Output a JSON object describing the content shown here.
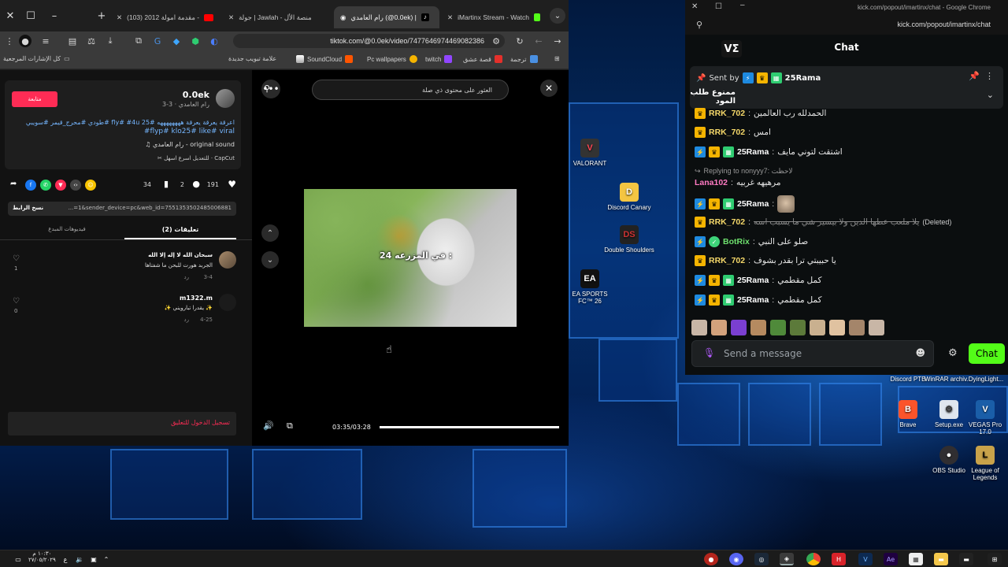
{
  "colors": {
    "kick_green": "#53fc18",
    "tiktok_red": "#fe2c55",
    "link_blue": "#75b6ff",
    "rrk_gold": "#f5d86a",
    "rama_white": "#ffffff",
    "lana_pink": "#ff7ac3",
    "botrix_green": "#6ee06e"
  },
  "chrome": {
    "tabs": [
      {
        "title": "iMartinx Stream - Watch",
        "icon": "kick-icon"
      },
      {
        "title": "رام العامدي (@0.0ek) |",
        "icon": "tiktok-icon"
      },
      {
        "title": "جولة | Jawlah - منصة الأل",
        "icon": "jawlah-icon"
      },
      {
        "title": "(103) مقدمة امولة 2012 -",
        "icon": "youtube-icon"
      }
    ],
    "new_tab": "+",
    "url": "tiktok.com/@0.0ek/video/7477646974469082386",
    "bookmarks": [
      {
        "label": "ترجمة",
        "icon": "translate-icon"
      },
      {
        "label": "قصة عشق",
        "icon": "bookmark-icon"
      },
      {
        "label": "twitch",
        "icon": "twitch-icon"
      },
      {
        "label": "Pc wallpapers",
        "icon": "wallpaper-icon"
      },
      {
        "label": "SoundCloud",
        "icon": "soundcloud-icon"
      },
      {
        "label": "علامة تبويب جديدة",
        "icon": "chrome-icon"
      },
      {
        "label": "كل الإشارات المرجعية",
        "icon": "folder-icon"
      }
    ]
  },
  "tiktok": {
    "username": "0.0ek",
    "display_name": "رام العامدي",
    "date": "3-3",
    "follow_label": "متابعة",
    "description": "اعرقة يعرقة يعرقة ههههههههه #25 fly# #4u #طودي #محرج_قيمر #سويبي",
    "hashtags2": "flyp# klo25# like# viral#",
    "sound": "original sound - رام العامدي",
    "capcut": "CapCut · للتعديل اسرع اسهل",
    "likes": "191",
    "comments_count": "2",
    "saves": "34",
    "copy_link_label": "نسخ الرابط",
    "link_text": "...=1&sender_device=pc&web_id=7551353502485006881",
    "tab_comments": "تعليقات (2)",
    "tab_creator_videos": "فيديوهات المبدع",
    "comments": [
      {
        "user": "سبحان الله لا إله إلا الله",
        "text": "الجربد هورت للبحن ما شفتاها",
        "date": "3-4",
        "reply": "رد",
        "likes": "1"
      },
      {
        "user": "m1322.m",
        "text": "✨ يقدرا تبارويني ✨",
        "date": "4-25",
        "reply": "رد",
        "likes": "0"
      }
    ],
    "login_prompt": "تسجيل الدخول للتعليق",
    "search_placeholder": "العثور على محتوى ذي صلة",
    "video_caption": "24 في المزرعه :",
    "time": "03:35/03:28"
  },
  "kick": {
    "window_url": "kick.com/popout/imartinx/chat - Google Chrome",
    "url": "kick.com/popout/imartinx/chat",
    "title": "Chat",
    "pinned_by_label": "Sent by",
    "pinned_user": "25Rama",
    "pinned_text": "ممنوع طلب المود",
    "messages": [
      {
        "user": "RRK_702",
        "text": "الحمدلله رب العالمين",
        "color_key": "rrk_gold",
        "badges": [
          "gold"
        ]
      },
      {
        "user": "RRK_702",
        "text": "امس",
        "color_key": "rrk_gold",
        "badges": [
          "gold"
        ]
      },
      {
        "user": "25Rama",
        "text": "اشتقت لتوني مايف",
        "color_key": "rama_white",
        "badges": [
          "blue",
          "gold",
          "green"
        ]
      },
      {
        "user": "Lana102",
        "text": "مرهيهه غربيه",
        "color_key": "lana_pink",
        "badges": [],
        "reply_to": "Replying to nonyyy7: لاحظت"
      },
      {
        "user": "25Rama",
        "text": "",
        "color_key": "rama_white",
        "badges": [
          "blue",
          "gold",
          "green"
        ],
        "emote": true
      },
      {
        "user": "RRK_702",
        "text": "يلا ملعب عطها الدين ولا بيسير شي ما يسبب اسه",
        "color_key": "rrk_gold",
        "badges": [
          "gold"
        ],
        "deleted": "(Deleted)"
      },
      {
        "user": "BotRix",
        "text": "صلو على النبي",
        "color_key": "botrix_green",
        "badges": [
          "blue",
          "check"
        ]
      },
      {
        "user": "RRK_702",
        "text": "يا حبيبتي ترا بقدر بشوف",
        "color_key": "rrk_gold",
        "badges": [
          "gold"
        ]
      },
      {
        "user": "25Rama",
        "text": "كمل مقطمي",
        "color_key": "rama_white",
        "badges": [
          "blue",
          "gold",
          "green"
        ]
      },
      {
        "user": "25Rama",
        "text": "كمل مقطمي",
        "color_key": "rama_white",
        "badges": [
          "blue",
          "gold",
          "green"
        ]
      }
    ],
    "input_placeholder": "Send a message",
    "chat_button": "Chat"
  },
  "desktop_icons": [
    {
      "label": "VALORANT",
      "icon": "valorant-icon"
    },
    {
      "label": "Discord Canary",
      "icon": "discord-canary-icon"
    },
    {
      "label": "Double Shoulders",
      "icon": "ds-icon"
    },
    {
      "label": "EA SPORTS FC™ 26",
      "icon": "ea-icon"
    },
    {
      "label": "Discord PTB",
      "icon": "discord-ptb-icon"
    },
    {
      "label": "WinRAR archiv...",
      "icon": "winrar-icon"
    },
    {
      "label": "DyingLight...",
      "icon": "dyinglight-icon"
    },
    {
      "label": "Brave",
      "icon": "brave-icon"
    },
    {
      "label": "Setup.exe",
      "icon": "setup-icon"
    },
    {
      "label": "VEGAS Pro 17.0",
      "icon": "vegas-icon"
    },
    {
      "label": "OBS Studio",
      "icon": "obs-icon"
    },
    {
      "label": "League of Legends",
      "icon": "lol-icon"
    }
  ],
  "taskbar": {
    "time": "١٠:٣٠ م",
    "date": "٢٧/٠٥/٢٠٢٩",
    "lang": "ع"
  }
}
